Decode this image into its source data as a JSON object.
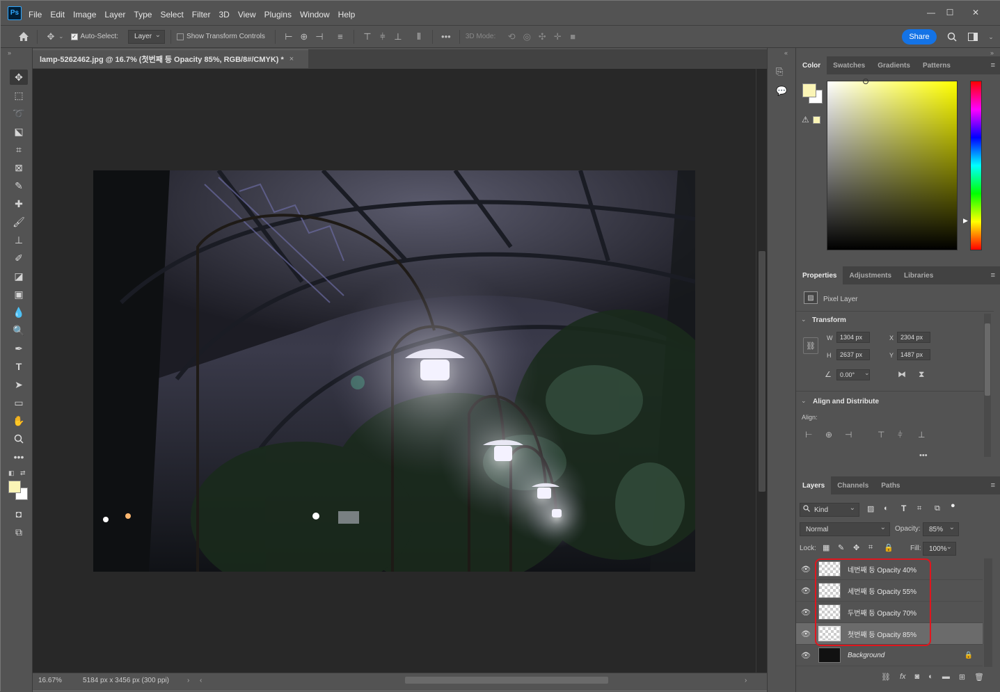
{
  "app": {
    "logo": "Ps"
  },
  "menu": [
    "File",
    "Edit",
    "Image",
    "Layer",
    "Type",
    "Select",
    "Filter",
    "3D",
    "View",
    "Plugins",
    "Window",
    "Help"
  ],
  "window_controls": {
    "minimize": "—",
    "maximize": "☐",
    "close": "✕"
  },
  "options_bar": {
    "auto_select_label": "Auto-Select:",
    "auto_select_value": "Layer",
    "show_transform_label": "Show Transform Controls",
    "three_d_mode_label": "3D Mode:",
    "share_label": "Share"
  },
  "document": {
    "tab_title": "lamp-5262462.jpg @ 16.7% (첫번째 등 Opacity 85%, RGB/8#/CMYK) *",
    "zoom": "16.67%",
    "size_info": "5184 px x 3456 px (300 ppi)"
  },
  "color_panel": {
    "tabs": [
      "Color",
      "Swatches",
      "Gradients",
      "Patterns"
    ],
    "foreground_color": "#fbf5b6",
    "background_color": "#ffffff"
  },
  "properties_panel": {
    "tabs": [
      "Properties",
      "Adjustments",
      "Libraries"
    ],
    "layer_type": "Pixel Layer",
    "transform_title": "Transform",
    "w_label": "W",
    "w_value": "1304 px",
    "h_label": "H",
    "h_value": "2637 px",
    "x_label": "X",
    "x_value": "2304 px",
    "y_label": "Y",
    "y_value": "1487 px",
    "angle_value": "0.00°",
    "align_title": "Align and Distribute",
    "align_label": "Align:"
  },
  "layers_panel": {
    "tabs": [
      "Layers",
      "Channels",
      "Paths"
    ],
    "filter_kind": "Kind",
    "blend_mode": "Normal",
    "opacity_label": "Opacity:",
    "opacity_value": "85%",
    "lock_label": "Lock:",
    "fill_label": "Fill:",
    "fill_value": "100%",
    "layers": [
      {
        "name": "네번째 등 Opacity 40%",
        "selected": false
      },
      {
        "name": "세번째 등 Opacity 55%",
        "selected": false
      },
      {
        "name": "두번째 등 Opacity 70%",
        "selected": false
      },
      {
        "name": "첫번째 등 Opacity 85%",
        "selected": true
      },
      {
        "name": "Background",
        "selected": false
      }
    ]
  }
}
